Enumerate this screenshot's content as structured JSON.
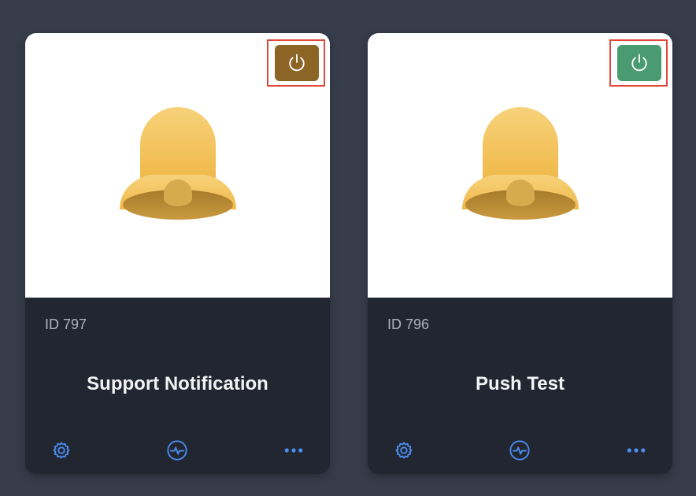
{
  "colors": {
    "background": "#363c4a",
    "card_body": "#222631",
    "card_top": "#ffffff",
    "power_off": "#8b6426",
    "power_on": "#4a9a72",
    "highlight_border": "#e0483a",
    "action_icon": "#4a8ef0",
    "bell": "#f2c14e"
  },
  "icons": {
    "card_image": "bell-icon",
    "power": "power-icon",
    "settings": "gear-icon",
    "activity": "activity-icon",
    "more": "more-horizontal-icon"
  },
  "cards": [
    {
      "id_label": "ID 797",
      "title": "Support Notification",
      "power_state": "off"
    },
    {
      "id_label": "ID 796",
      "title": "Push Test",
      "power_state": "on"
    }
  ]
}
